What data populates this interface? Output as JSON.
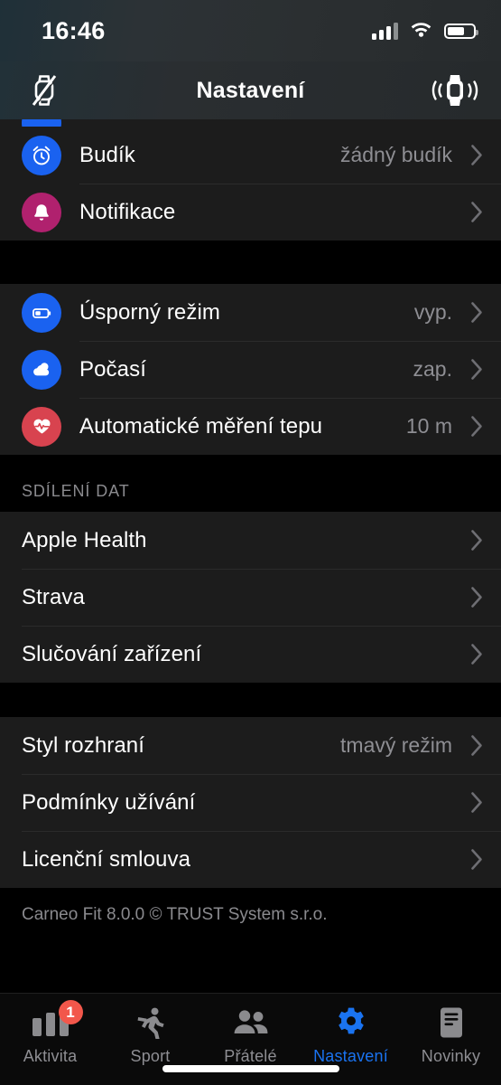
{
  "status_bar": {
    "time": "16:46",
    "signal_icon": "cellular-signal-icon",
    "wifi_icon": "wifi-icon",
    "battery_icon": "battery-icon",
    "battery_level_pct": 66
  },
  "header": {
    "title": "Nastavení",
    "left_icon": "watch-disconnected-icon",
    "right_icon": "watch-vibration-icon"
  },
  "sections": [
    {
      "id": "device",
      "header": "",
      "rows": [
        {
          "label": "Budík",
          "value": "žádný budík",
          "icon": "alarm-clock-icon",
          "icon_color": "#1a62f0",
          "has_icon": true,
          "chevron": true
        },
        {
          "label": "Notifikace",
          "value": "",
          "icon": "bell-icon",
          "icon_color": "#b0216e",
          "has_icon": true,
          "chevron": true
        }
      ]
    },
    {
      "id": "features",
      "header": "",
      "rows": [
        {
          "label": "Úsporný režim",
          "value": "vyp.",
          "icon": "battery-saver-icon",
          "icon_color": "#1a62f0",
          "has_icon": true,
          "chevron": true
        },
        {
          "label": "Počasí",
          "value": "zap.",
          "icon": "weather-cloud-icon",
          "icon_color": "#1a62f0",
          "has_icon": true,
          "chevron": true
        },
        {
          "label": "Automatické měření tepu",
          "value": "10 m",
          "icon": "heart-rate-icon",
          "icon_color": "#d8434f",
          "has_icon": true,
          "chevron": true
        }
      ]
    },
    {
      "id": "data-sharing",
      "header": "SDÍLENÍ DAT",
      "rows": [
        {
          "label": "Apple Health",
          "value": "",
          "icon": "",
          "icon_color": "",
          "has_icon": false,
          "chevron": true
        },
        {
          "label": "Strava",
          "value": "",
          "icon": "",
          "icon_color": "",
          "has_icon": false,
          "chevron": true
        },
        {
          "label": "Slučování zařízení",
          "value": "",
          "icon": "",
          "icon_color": "",
          "has_icon": false,
          "chevron": true
        }
      ]
    },
    {
      "id": "about",
      "header": "",
      "rows": [
        {
          "label": "Styl rozhraní",
          "value": "tmavý režim",
          "icon": "",
          "icon_color": "",
          "has_icon": false,
          "chevron": true
        },
        {
          "label": "Podmínky užívání",
          "value": "",
          "icon": "",
          "icon_color": "",
          "has_icon": false,
          "chevron": true
        },
        {
          "label": "Licenční smlouva",
          "value": "",
          "icon": "",
          "icon_color": "",
          "has_icon": false,
          "chevron": true
        }
      ]
    }
  ],
  "footer_note": "Carneo Fit  8.0.0  © TRUST System s.r.o.",
  "tabbar": {
    "items": [
      {
        "label": "Aktivita",
        "icon": "activity-bars-icon",
        "active": false,
        "badge": "1"
      },
      {
        "label": "Sport",
        "icon": "running-person-icon",
        "active": false,
        "badge": ""
      },
      {
        "label": "Přátelé",
        "icon": "people-icon",
        "active": false,
        "badge": ""
      },
      {
        "label": "Nastavení",
        "icon": "gear-icon",
        "active": true,
        "badge": ""
      },
      {
        "label": "Novinky",
        "icon": "news-document-icon",
        "active": false,
        "badge": ""
      }
    ],
    "active_color": "#1a73f0",
    "inactive_color": "#8e8e93",
    "badge_color": "#f2574b"
  }
}
